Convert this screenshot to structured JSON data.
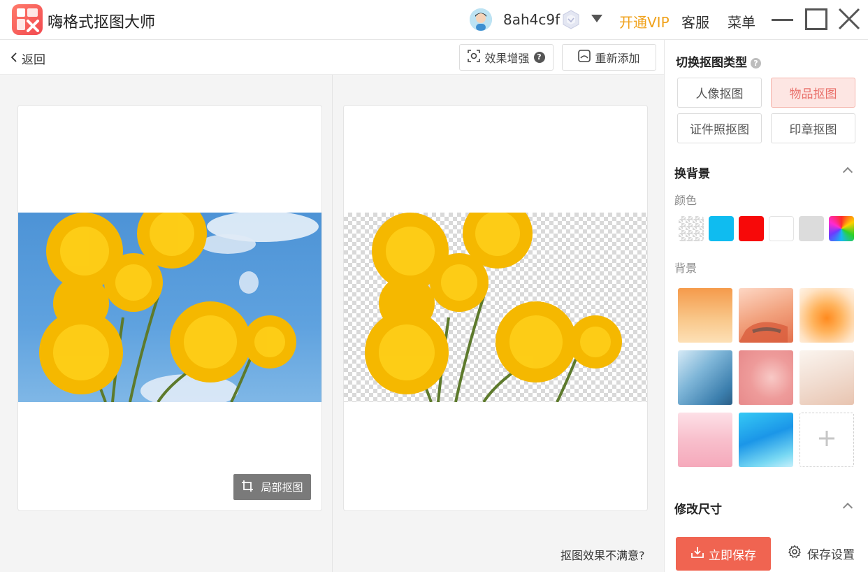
{
  "app": {
    "title": "嗨格式抠图大师"
  },
  "header": {
    "username": "8ah4c9f",
    "open_vip": "开通VIP",
    "service": "客服",
    "menu": "菜单"
  },
  "toolbar": {
    "back": "返回",
    "enhance": "效果增强",
    "readd": "重新添加"
  },
  "canvas": {
    "partial_cutout": "局部抠图",
    "unsatisfied": "抠图效果不满意?"
  },
  "panel": {
    "switch_type_title": "切换抠图类型",
    "types": [
      {
        "label": "人像抠图",
        "active": false
      },
      {
        "label": "物品抠图",
        "active": true
      },
      {
        "label": "证件照抠图",
        "active": false
      },
      {
        "label": "印章抠图",
        "active": false
      }
    ],
    "change_bg_title": "换背景",
    "color_label": "颜色",
    "colors": [
      "transparent",
      "#0fbcf0",
      "#f70909",
      "#ffffff",
      "#dcdcdc",
      "rainbow"
    ],
    "background_label": "背景",
    "resize_title": "修改尺寸",
    "save_now": "立即保存",
    "save_settings": "保存设置"
  },
  "colors": {
    "accent": "#f06451",
    "vip": "#f0a11a",
    "active_bg": "#fde6e3",
    "active_text": "#e9706a"
  }
}
